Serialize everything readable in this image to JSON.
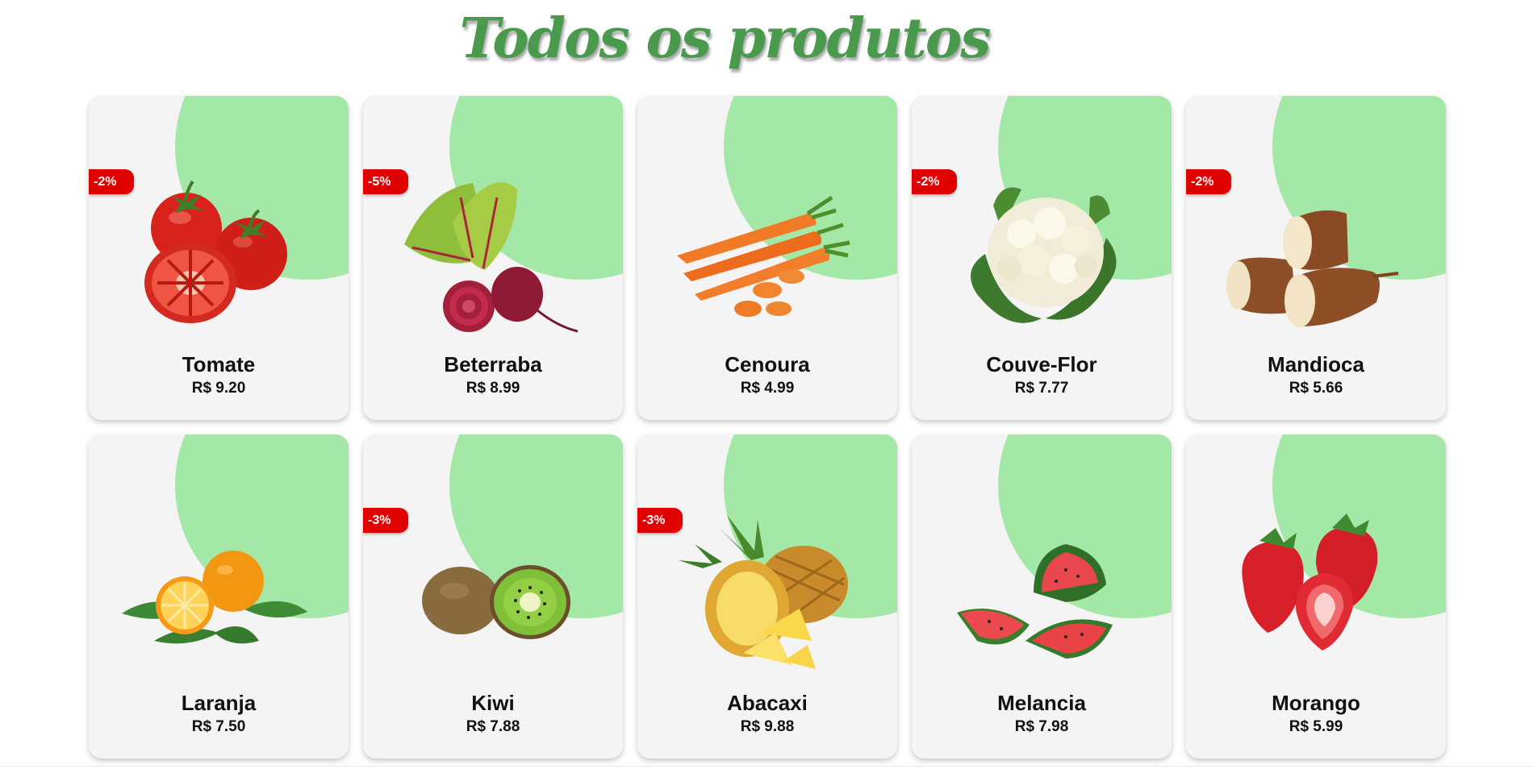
{
  "page": {
    "title": "Todos os produtos"
  },
  "colors": {
    "title": "#4a9a4e",
    "card_background": "#f4f4f4",
    "blob": "#a4e8a8",
    "discount_badge": "#e00000"
  },
  "products": [
    {
      "name": "Tomate",
      "price": "R$ 9.20",
      "discount": "-2%",
      "icon": "tomato-image"
    },
    {
      "name": "Beterraba",
      "price": "R$ 8.99",
      "discount": "-5%",
      "icon": "beet-image"
    },
    {
      "name": "Cenoura",
      "price": "R$ 4.99",
      "discount": "",
      "icon": "carrot-image"
    },
    {
      "name": "Couve-Flor",
      "price": "R$ 7.77",
      "discount": "-2%",
      "icon": "cauliflower-image"
    },
    {
      "name": "Mandioca",
      "price": "R$ 5.66",
      "discount": "-2%",
      "icon": "cassava-image"
    },
    {
      "name": "Laranja",
      "price": "R$ 7.50",
      "discount": "",
      "icon": "orange-image"
    },
    {
      "name": "Kiwi",
      "price": "R$ 7.88",
      "discount": "-3%",
      "icon": "kiwi-image"
    },
    {
      "name": "Abacaxi",
      "price": "R$ 9.88",
      "discount": "-3%",
      "icon": "pineapple-image"
    },
    {
      "name": "Melancia",
      "price": "R$ 7.98",
      "discount": "",
      "icon": "watermelon-image"
    },
    {
      "name": "Morango",
      "price": "R$ 5.99",
      "discount": "",
      "icon": "strawberry-image"
    }
  ]
}
